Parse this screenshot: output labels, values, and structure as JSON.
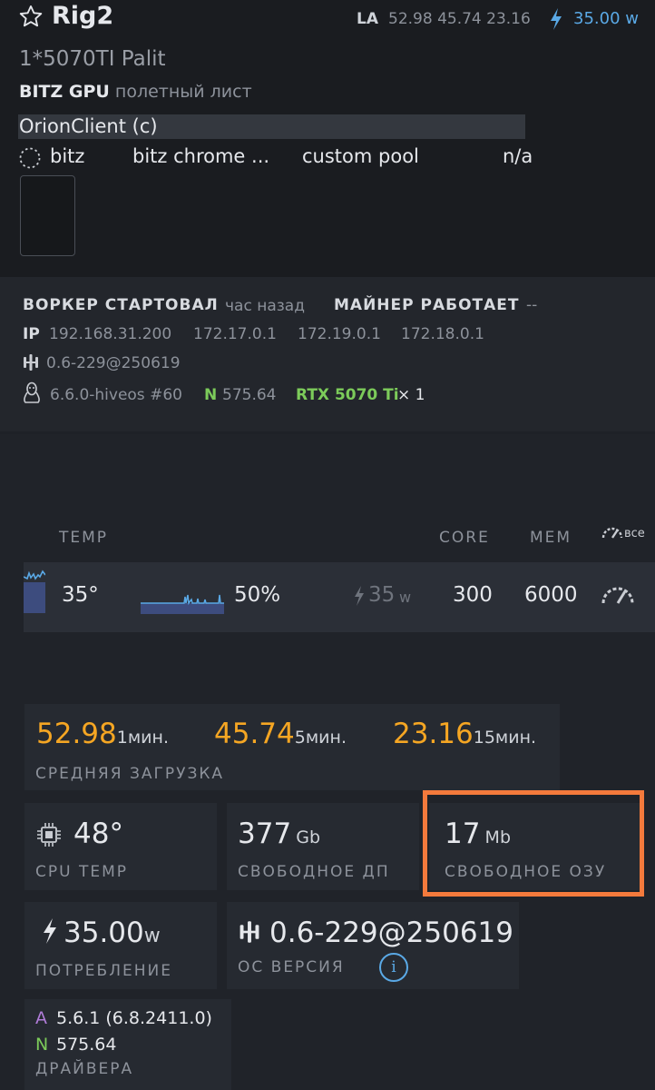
{
  "header": {
    "title": "Rig2",
    "la_label": "LA",
    "la_values": "52.98 45.74 23.16",
    "power": "35.00",
    "power_unit": "w"
  },
  "rig": {
    "description": "1*5070TI Palit",
    "flight_sheet_name": "BITZ GPU",
    "flight_sheet_suffix": "полетный лист",
    "client": "OrionClient (c)"
  },
  "miner": {
    "coin": "bitz",
    "wallet": "bitz chrome ...",
    "pool": "custom pool",
    "hashrate": "n/a"
  },
  "status": {
    "worker_label": "ВОРКЕР СТАРТОВАЛ",
    "worker_time": "час назад",
    "miner_label": "МАЙНЕР РАБОТАЕТ",
    "miner_value": "--",
    "ip_label": "IP",
    "ips": [
      "192.168.31.200",
      "172.17.0.1",
      "172.19.0.1",
      "172.18.0.1"
    ],
    "os_version": "0.6-229@250619",
    "kernel": "6.6.0-hiveos #60",
    "driver_prefix": "N",
    "driver": "575.64",
    "gpu_model": "RTX 5070 Ti",
    "gpu_count": "× 1"
  },
  "gpu_table": {
    "headers": {
      "temp": "TEMP",
      "core": "CORE",
      "mem": "MEM",
      "all": "все"
    },
    "row": {
      "temp": "35°",
      "fan": "50%",
      "power": "35",
      "power_unit": "w",
      "core": "300",
      "mem": "6000"
    }
  },
  "load": {
    "values": [
      {
        "value": "52.98",
        "unit": "1мин."
      },
      {
        "value": "45.74",
        "unit": "5мин."
      },
      {
        "value": "23.16",
        "unit": "15мин."
      }
    ],
    "label": "СРЕДНЯЯ ЗАГРУЗКА"
  },
  "stats": {
    "cpu_temp": {
      "value": "48°",
      "label": "CPU TEMP"
    },
    "free_disk": {
      "value": "377",
      "unit": "Gb",
      "label": "СВОБОДНОЕ ДП"
    },
    "free_ram": {
      "value": "17",
      "unit": "Mb",
      "label": "СВОБОДНОЕ ОЗУ"
    },
    "power": {
      "value": "35.00",
      "unit": "w",
      "label": "ПОТРЕБЛЕНИЕ"
    },
    "os": {
      "value": "0.6-229@250619",
      "label": "ОС ВЕРСИЯ",
      "info": "i"
    },
    "drivers": {
      "amd_prefix": "A",
      "amd": "5.6.1 (6.8.2411.0)",
      "nvidia_prefix": "N",
      "nvidia": "575.64",
      "label": "ДРАЙВЕРА"
    }
  },
  "colors": {
    "accent_blue": "#5aa9e6",
    "orange": "#f5a623",
    "green": "#7ccb5a",
    "highlight": "#f47a3c",
    "purple": "#b07cd8"
  }
}
